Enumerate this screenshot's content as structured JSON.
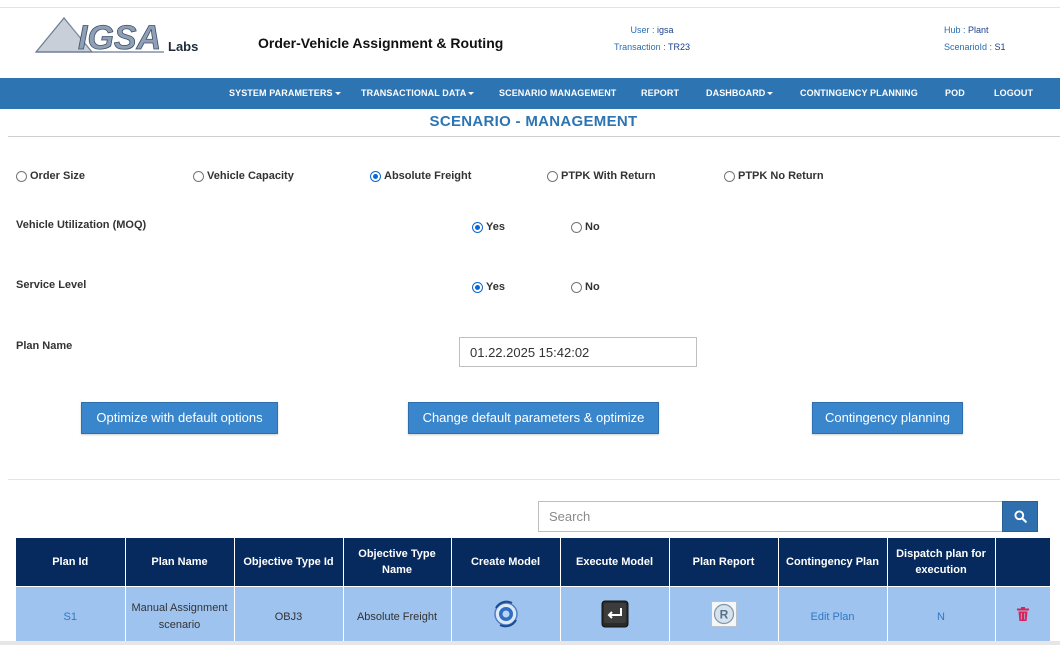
{
  "header": {
    "logo_text": "IGSA",
    "logo_suffix": "Labs",
    "app_title": "Order-Vehicle Assignment & Routing",
    "user_label": "User :",
    "user_value": "igsa",
    "transaction_label": "Transaction :",
    "transaction_value": "TR23",
    "hub_label": "Hub :",
    "hub_value": "Plant",
    "scenario_label": "ScenarioId :",
    "scenario_value": "S1"
  },
  "nav": {
    "items": [
      {
        "label": "SYSTEM PARAMETERS",
        "dropdown": true
      },
      {
        "label": "TRANSACTIONAL DATA",
        "dropdown": true
      },
      {
        "label": "SCENARIO MANAGEMENT",
        "dropdown": false
      },
      {
        "label": "REPORT",
        "dropdown": false
      },
      {
        "label": "DASHBOARD",
        "dropdown": true
      },
      {
        "label": "CONTINGENCY PLANNING",
        "dropdown": false
      },
      {
        "label": "POD",
        "dropdown": false
      },
      {
        "label": "LOGOUT",
        "dropdown": false
      }
    ]
  },
  "page_title": "SCENARIO - MANAGEMENT",
  "objective": {
    "options": [
      "Order Size",
      "Vehicle Capacity",
      "Absolute Freight",
      "PTPK With Return",
      "PTPK No Return"
    ],
    "selected": "Absolute Freight"
  },
  "vehicle_utilization": {
    "label": "Vehicle Utilization (MOQ)",
    "yes": "Yes",
    "no": "No",
    "selected": "Yes"
  },
  "service_level": {
    "label": "Service Level",
    "yes": "Yes",
    "no": "No",
    "selected": "Yes"
  },
  "plan_name": {
    "label": "Plan Name",
    "value": "01.22.2025 15:42:02"
  },
  "buttons": {
    "optimize_default": "Optimize with default options",
    "change_params": "Change default parameters & optimize",
    "contingency": "Contingency planning"
  },
  "search": {
    "placeholder": "Search"
  },
  "table": {
    "headers": [
      "Plan Id",
      "Plan Name",
      "Objective Type Id",
      "Objective Type Name",
      "Create Model",
      "Execute Model",
      "Plan Report",
      "Contingency Plan",
      "Dispatch plan for execution",
      ""
    ],
    "rows": [
      {
        "plan_id": "S1",
        "plan_name": "Manual Assignment scenario",
        "objective_type_id": "OBJ3",
        "objective_type_name": "Absolute Freight",
        "create_model_icon": "gear-globe-icon",
        "execute_model_icon": "enter-key-icon",
        "plan_report_icon": "report-r-icon",
        "contingency_plan": "Edit Plan",
        "dispatch": "N",
        "delete_icon": "trash-icon"
      }
    ]
  },
  "colors": {
    "nav_bg": "#2d74b2",
    "accent": "#2d74b2",
    "table_header": "#072a5e",
    "table_row": "#9fc3ef",
    "button": "#3a86cc",
    "delete": "#d6245a"
  }
}
